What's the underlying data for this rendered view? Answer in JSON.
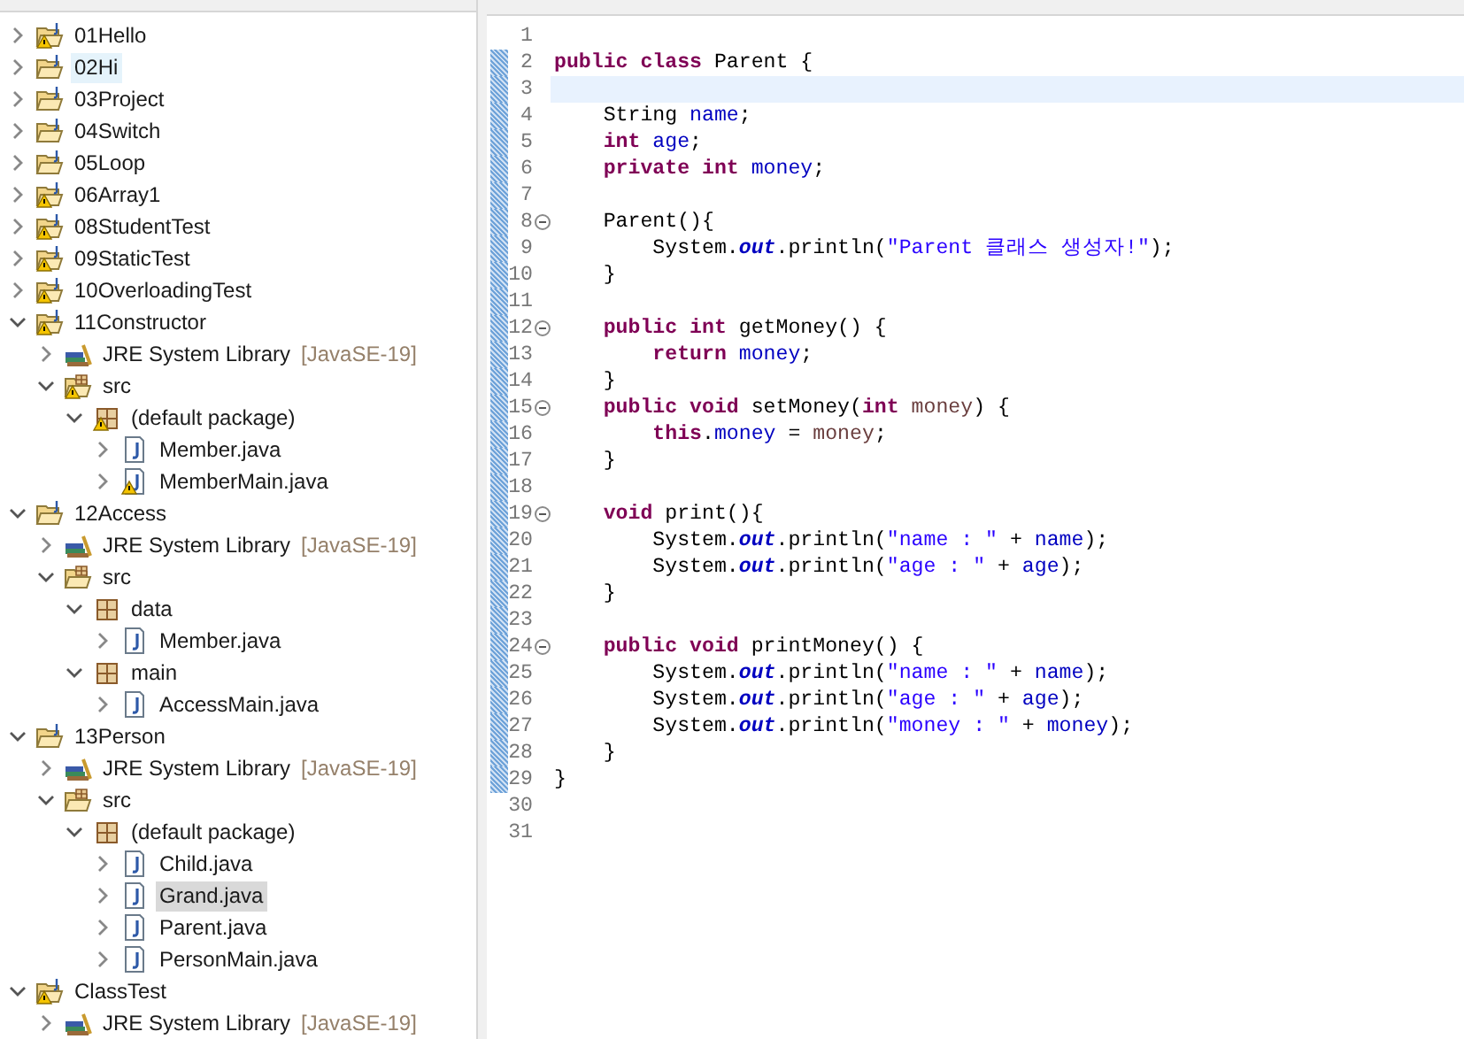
{
  "package_explorer": {
    "tree": [
      {
        "label": "01Hello",
        "kind": "project",
        "warning": true,
        "expanded": false,
        "selected": false,
        "hovered": false
      },
      {
        "label": "02Hi",
        "kind": "project",
        "warning": false,
        "expanded": false,
        "selected": false,
        "hovered": true
      },
      {
        "label": "03Project",
        "kind": "project",
        "warning": false,
        "expanded": false,
        "selected": false,
        "hovered": false
      },
      {
        "label": "04Switch",
        "kind": "project",
        "warning": false,
        "expanded": false,
        "selected": false,
        "hovered": false
      },
      {
        "label": "05Loop",
        "kind": "project",
        "warning": false,
        "expanded": false,
        "selected": false,
        "hovered": false
      },
      {
        "label": "06Array1",
        "kind": "project",
        "warning": true,
        "expanded": false,
        "selected": false,
        "hovered": false
      },
      {
        "label": "08StudentTest",
        "kind": "project",
        "warning": true,
        "expanded": false,
        "selected": false,
        "hovered": false
      },
      {
        "label": "09StaticTest",
        "kind": "project",
        "warning": true,
        "expanded": false,
        "selected": false,
        "hovered": false
      },
      {
        "label": "10OverloadingTest",
        "kind": "project",
        "warning": true,
        "expanded": false,
        "selected": false,
        "hovered": false
      },
      {
        "label": "11Constructor",
        "kind": "project",
        "warning": true,
        "expanded": true,
        "selected": false,
        "hovered": false,
        "children": [
          {
            "label": "JRE System Library",
            "decoration": "[JavaSE-19]",
            "kind": "library",
            "warning": false,
            "expanded": false,
            "selected": false,
            "hovered": false
          },
          {
            "label": "src",
            "kind": "source-folder",
            "warning": true,
            "expanded": true,
            "selected": false,
            "hovered": false,
            "children": [
              {
                "label": "(default package)",
                "kind": "package",
                "warning": true,
                "expanded": true,
                "selected": false,
                "hovered": false,
                "children": [
                  {
                    "label": "Member.java",
                    "kind": "java-file",
                    "warning": false,
                    "expanded": false,
                    "selected": false,
                    "hovered": false
                  },
                  {
                    "label": "MemberMain.java",
                    "kind": "java-file",
                    "warning": true,
                    "expanded": false,
                    "selected": false,
                    "hovered": false
                  }
                ]
              }
            ]
          }
        ]
      },
      {
        "label": "12Access",
        "kind": "project",
        "warning": false,
        "expanded": true,
        "selected": false,
        "hovered": false,
        "children": [
          {
            "label": "JRE System Library",
            "decoration": "[JavaSE-19]",
            "kind": "library",
            "warning": false,
            "expanded": false,
            "selected": false,
            "hovered": false
          },
          {
            "label": "src",
            "kind": "source-folder",
            "warning": false,
            "expanded": true,
            "selected": false,
            "hovered": false,
            "children": [
              {
                "label": "data",
                "kind": "package",
                "warning": false,
                "expanded": true,
                "selected": false,
                "hovered": false,
                "children": [
                  {
                    "label": "Member.java",
                    "kind": "java-file",
                    "warning": false,
                    "expanded": false,
                    "selected": false,
                    "hovered": false
                  }
                ]
              },
              {
                "label": "main",
                "kind": "package",
                "warning": false,
                "expanded": true,
                "selected": false,
                "hovered": false,
                "children": [
                  {
                    "label": "AccessMain.java",
                    "kind": "java-file",
                    "warning": false,
                    "expanded": false,
                    "selected": false,
                    "hovered": false
                  }
                ]
              }
            ]
          }
        ]
      },
      {
        "label": "13Person",
        "kind": "project",
        "warning": false,
        "expanded": true,
        "selected": false,
        "hovered": false,
        "children": [
          {
            "label": "JRE System Library",
            "decoration": "[JavaSE-19]",
            "kind": "library",
            "warning": false,
            "expanded": false,
            "selected": false,
            "hovered": false
          },
          {
            "label": "src",
            "kind": "source-folder",
            "warning": false,
            "expanded": true,
            "selected": false,
            "hovered": false,
            "children": [
              {
                "label": "(default package)",
                "kind": "package",
                "warning": false,
                "expanded": true,
                "selected": false,
                "hovered": false,
                "children": [
                  {
                    "label": "Child.java",
                    "kind": "java-file",
                    "warning": false,
                    "expanded": false,
                    "selected": false,
                    "hovered": false
                  },
                  {
                    "label": "Grand.java",
                    "kind": "java-file",
                    "warning": false,
                    "expanded": false,
                    "selected": true,
                    "hovered": false
                  },
                  {
                    "label": "Parent.java",
                    "kind": "java-file",
                    "warning": false,
                    "expanded": false,
                    "selected": false,
                    "hovered": false
                  },
                  {
                    "label": "PersonMain.java",
                    "kind": "java-file",
                    "warning": false,
                    "expanded": false,
                    "selected": false,
                    "hovered": false
                  }
                ]
              }
            ]
          }
        ]
      },
      {
        "label": "ClassTest",
        "kind": "project",
        "warning": true,
        "expanded": true,
        "selected": false,
        "hovered": false,
        "children": [
          {
            "label": "JRE System Library",
            "decoration": "[JavaSE-19]",
            "kind": "library",
            "warning": false,
            "expanded": false,
            "selected": false,
            "hovered": false
          }
        ]
      }
    ]
  },
  "editor": {
    "lines": [
      {
        "number": "1",
        "changed": false,
        "current": false,
        "foldable": false
      },
      {
        "number": "2",
        "changed": true,
        "current": false,
        "foldable": false,
        "tokens": [
          {
            "kind": "keyword",
            "text": "public class"
          },
          {
            "kind": "plain",
            "text": " Parent {"
          }
        ]
      },
      {
        "number": "3",
        "changed": true,
        "current": true,
        "foldable": false
      },
      {
        "number": "4",
        "changed": true,
        "current": false,
        "foldable": false,
        "tokens": [
          {
            "kind": "plain",
            "text": "    String "
          },
          {
            "kind": "field",
            "text": "name"
          },
          {
            "kind": "plain",
            "text": ";"
          }
        ]
      },
      {
        "number": "5",
        "changed": true,
        "current": false,
        "foldable": false,
        "tokens": [
          {
            "kind": "keyword",
            "text": "    int"
          },
          {
            "kind": "field",
            "text": " age"
          },
          {
            "kind": "plain",
            "text": ";"
          }
        ]
      },
      {
        "number": "6",
        "changed": true,
        "current": false,
        "foldable": false,
        "tokens": [
          {
            "kind": "keyword",
            "text": "    private int"
          },
          {
            "kind": "field",
            "text": " money"
          },
          {
            "kind": "plain",
            "text": ";"
          }
        ]
      },
      {
        "number": "7",
        "changed": true,
        "current": false,
        "foldable": false
      },
      {
        "number": "8",
        "changed": true,
        "current": false,
        "foldable": true,
        "tokens": [
          {
            "kind": "plain",
            "text": "    Parent(){"
          }
        ]
      },
      {
        "number": "9",
        "changed": true,
        "current": false,
        "foldable": false,
        "tokens": [
          {
            "kind": "plain",
            "text": "        System."
          },
          {
            "kind": "static",
            "text": "out"
          },
          {
            "kind": "plain",
            "text": ".println("
          },
          {
            "kind": "string",
            "text": "\"Parent 클래스 생성자!\""
          },
          {
            "kind": "plain",
            "text": ");"
          }
        ]
      },
      {
        "number": "10",
        "changed": true,
        "current": false,
        "foldable": false,
        "tokens": [
          {
            "kind": "plain",
            "text": "    }"
          }
        ]
      },
      {
        "number": "11",
        "changed": true,
        "current": false,
        "foldable": false
      },
      {
        "number": "12",
        "changed": true,
        "current": false,
        "foldable": true,
        "tokens": [
          {
            "kind": "keyword",
            "text": "    public int"
          },
          {
            "kind": "plain",
            "text": " getMoney() {"
          }
        ]
      },
      {
        "number": "13",
        "changed": true,
        "current": false,
        "foldable": false,
        "tokens": [
          {
            "kind": "keyword",
            "text": "        return"
          },
          {
            "kind": "field",
            "text": " money"
          },
          {
            "kind": "plain",
            "text": ";"
          }
        ]
      },
      {
        "number": "14",
        "changed": true,
        "current": false,
        "foldable": false,
        "tokens": [
          {
            "kind": "plain",
            "text": "    }"
          }
        ]
      },
      {
        "number": "15",
        "changed": true,
        "current": false,
        "foldable": true,
        "tokens": [
          {
            "kind": "keyword",
            "text": "    public void"
          },
          {
            "kind": "plain",
            "text": " setMoney("
          },
          {
            "kind": "keyword",
            "text": "int"
          },
          {
            "kind": "local",
            "text": " money"
          },
          {
            "kind": "plain",
            "text": ") {"
          }
        ]
      },
      {
        "number": "16",
        "changed": true,
        "current": false,
        "foldable": false,
        "tokens": [
          {
            "kind": "keyword",
            "text": "        this"
          },
          {
            "kind": "plain",
            "text": "."
          },
          {
            "kind": "field",
            "text": "money"
          },
          {
            "kind": "plain",
            "text": " = "
          },
          {
            "kind": "local",
            "text": "money"
          },
          {
            "kind": "plain",
            "text": ";"
          }
        ]
      },
      {
        "number": "17",
        "changed": true,
        "current": false,
        "foldable": false,
        "tokens": [
          {
            "kind": "plain",
            "text": "    }"
          }
        ]
      },
      {
        "number": "18",
        "changed": true,
        "current": false,
        "foldable": false
      },
      {
        "number": "19",
        "changed": true,
        "current": false,
        "foldable": true,
        "tokens": [
          {
            "kind": "keyword",
            "text": "    void"
          },
          {
            "kind": "plain",
            "text": " print(){"
          }
        ]
      },
      {
        "number": "20",
        "changed": true,
        "current": false,
        "foldable": false,
        "tokens": [
          {
            "kind": "plain",
            "text": "        System."
          },
          {
            "kind": "static",
            "text": "out"
          },
          {
            "kind": "plain",
            "text": ".println("
          },
          {
            "kind": "string",
            "text": "\"name : \""
          },
          {
            "kind": "plain",
            "text": " + "
          },
          {
            "kind": "field",
            "text": "name"
          },
          {
            "kind": "plain",
            "text": ");"
          }
        ]
      },
      {
        "number": "21",
        "changed": true,
        "current": false,
        "foldable": false,
        "tokens": [
          {
            "kind": "plain",
            "text": "        System."
          },
          {
            "kind": "static",
            "text": "out"
          },
          {
            "kind": "plain",
            "text": ".println("
          },
          {
            "kind": "string",
            "text": "\"age : \""
          },
          {
            "kind": "plain",
            "text": " + "
          },
          {
            "kind": "field",
            "text": "age"
          },
          {
            "kind": "plain",
            "text": ");"
          }
        ]
      },
      {
        "number": "22",
        "changed": true,
        "current": false,
        "foldable": false,
        "tokens": [
          {
            "kind": "plain",
            "text": "    }"
          }
        ]
      },
      {
        "number": "23",
        "changed": true,
        "current": false,
        "foldable": false
      },
      {
        "number": "24",
        "changed": true,
        "current": false,
        "foldable": true,
        "tokens": [
          {
            "kind": "keyword",
            "text": "    public void"
          },
          {
            "kind": "plain",
            "text": " printMoney() {"
          }
        ]
      },
      {
        "number": "25",
        "changed": true,
        "current": false,
        "foldable": false,
        "tokens": [
          {
            "kind": "plain",
            "text": "        System."
          },
          {
            "kind": "static",
            "text": "out"
          },
          {
            "kind": "plain",
            "text": ".println("
          },
          {
            "kind": "string",
            "text": "\"name : \""
          },
          {
            "kind": "plain",
            "text": " + "
          },
          {
            "kind": "field",
            "text": "name"
          },
          {
            "kind": "plain",
            "text": ");"
          }
        ]
      },
      {
        "number": "26",
        "changed": true,
        "current": false,
        "foldable": false,
        "tokens": [
          {
            "kind": "plain",
            "text": "        System."
          },
          {
            "kind": "static",
            "text": "out"
          },
          {
            "kind": "plain",
            "text": ".println("
          },
          {
            "kind": "string",
            "text": "\"age : \""
          },
          {
            "kind": "plain",
            "text": " + "
          },
          {
            "kind": "field",
            "text": "age"
          },
          {
            "kind": "plain",
            "text": ");"
          }
        ]
      },
      {
        "number": "27",
        "changed": true,
        "current": false,
        "foldable": false,
        "tokens": [
          {
            "kind": "plain",
            "text": "        System."
          },
          {
            "kind": "static",
            "text": "out"
          },
          {
            "kind": "plain",
            "text": ".println("
          },
          {
            "kind": "string",
            "text": "\"money : \""
          },
          {
            "kind": "plain",
            "text": " + "
          },
          {
            "kind": "field",
            "text": "money"
          },
          {
            "kind": "plain",
            "text": ");"
          }
        ]
      },
      {
        "number": "28",
        "changed": true,
        "current": false,
        "foldable": false,
        "tokens": [
          {
            "kind": "plain",
            "text": "    }"
          }
        ]
      },
      {
        "number": "29",
        "changed": true,
        "current": false,
        "foldable": false,
        "tokens": [
          {
            "kind": "plain",
            "text": "}"
          }
        ]
      },
      {
        "number": "30",
        "changed": false,
        "current": false,
        "foldable": false
      },
      {
        "number": "31",
        "changed": false,
        "current": false,
        "foldable": false
      }
    ]
  }
}
